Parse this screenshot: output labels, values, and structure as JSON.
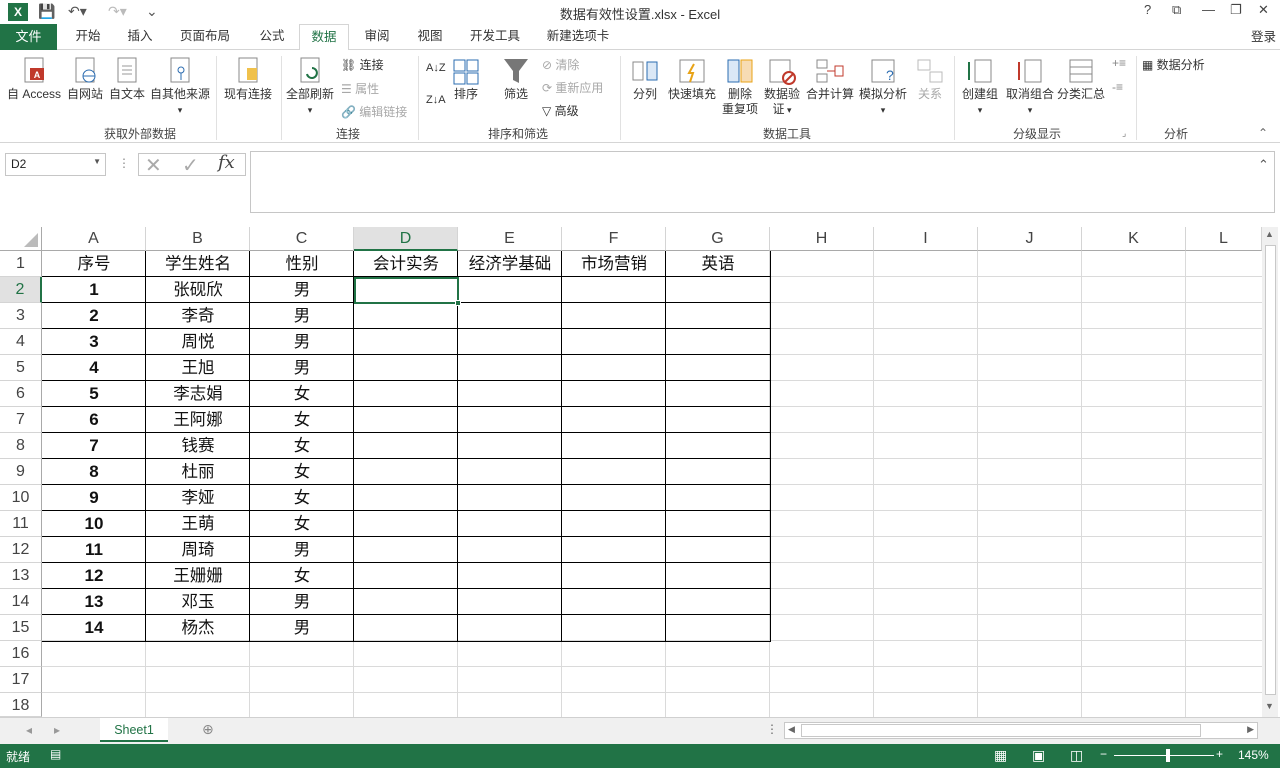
{
  "title": "数据有效性设置.xlsx - Excel",
  "app_icon": "X",
  "window_controls": [
    "?",
    "⧉",
    "—",
    "❐",
    "✕"
  ],
  "tabs": {
    "file": "文件",
    "items": [
      "开始",
      "插入",
      "页面布局",
      "公式",
      "数据",
      "审阅",
      "视图",
      "开发工具",
      "新建选项卡"
    ],
    "active": "数据",
    "login": "登录"
  },
  "ribbon": {
    "get_external": {
      "access": "自 Access",
      "web": "自网站",
      "text": "自文本",
      "other": "自其他来源",
      "existing": "现有连接",
      "label": "获取外部数据"
    },
    "connections": {
      "refresh_all": "全部刷新",
      "connections": "连接",
      "properties": "属性",
      "edit_links": "编辑链接",
      "label": "连接"
    },
    "sort_filter": {
      "sort": "排序",
      "filter": "筛选",
      "clear": "清除",
      "reapply": "重新应用",
      "advanced": "高级",
      "label": "排序和筛选"
    },
    "data_tools": {
      "split": "分列",
      "flash_fill": "快速填充",
      "remove_dup_1": "删除",
      "remove_dup_2": "重复项",
      "validation_1": "数据验",
      "validation_2": "证",
      "consolidate": "合并计算",
      "whatif": "模拟分析",
      "relationships": "关系",
      "label": "数据工具"
    },
    "outline": {
      "group": "创建组",
      "ungroup": "取消组合",
      "subtotal": "分类汇总",
      "label": "分级显示"
    },
    "analysis": {
      "data_analysis": "数据分析",
      "label": "分析"
    }
  },
  "namebox": "D2",
  "fx": "fx",
  "columns": [
    "A",
    "B",
    "C",
    "D",
    "E",
    "F",
    "G",
    "H",
    "I",
    "J",
    "K",
    "L"
  ],
  "rows": [
    "1",
    "2",
    "3",
    "4",
    "5",
    "6",
    "7",
    "8",
    "9",
    "10",
    "11",
    "12",
    "13",
    "14",
    "15",
    "16",
    "17",
    "18"
  ],
  "headers": [
    "序号",
    "学生姓名",
    "性别",
    "会计实务",
    "经济学基础",
    "市场营销",
    "英语"
  ],
  "students": [
    [
      "1",
      "张砚欣",
      "男"
    ],
    [
      "2",
      "李奇",
      "男"
    ],
    [
      "3",
      "周悦",
      "男"
    ],
    [
      "4",
      "王旭",
      "男"
    ],
    [
      "5",
      "李志娟",
      "女"
    ],
    [
      "6",
      "王阿娜",
      "女"
    ],
    [
      "7",
      "钱赛",
      "女"
    ],
    [
      "8",
      "杜丽",
      "女"
    ],
    [
      "9",
      "李娅",
      "女"
    ],
    [
      "10",
      "王萌",
      "女"
    ],
    [
      "11",
      "周琦",
      "男"
    ],
    [
      "12",
      "王姗姗",
      "女"
    ],
    [
      "13",
      "邓玉",
      "男"
    ],
    [
      "14",
      "杨杰",
      "男"
    ]
  ],
  "sheet_tab": "Sheet1",
  "status": "就绪",
  "zoom": "145%",
  "colors": {
    "accent": "#217346"
  }
}
